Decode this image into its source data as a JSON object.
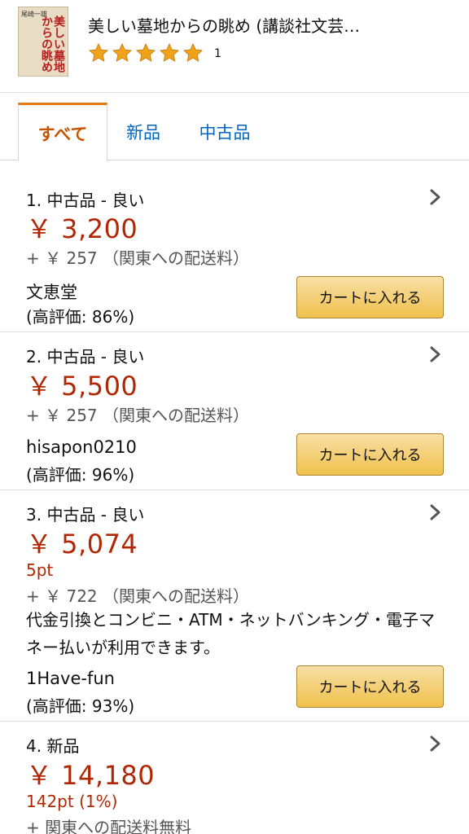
{
  "product": {
    "title": "美しい墓地からの眺め (講談社文芸…",
    "cover_title": "美しい墓地からの眺め",
    "cover_author": "尾崎一雄",
    "rating_stars": 5,
    "rating_count": "1",
    "star_color": "#f0a21a"
  },
  "tabs": [
    {
      "label": "すべて",
      "active": true
    },
    {
      "label": "新品",
      "active": false
    },
    {
      "label": "中古品",
      "active": false
    }
  ],
  "offers": [
    {
      "condition": "1. 中古品 - 良い",
      "price": "￥ 3,200",
      "shipping": "+ ￥ 257 （関東への配送料）",
      "seller": "文恵堂",
      "rating": "(高評価: 86%)",
      "cart_label": "カートに入れる"
    },
    {
      "condition": "2. 中古品 - 良い",
      "price": "￥ 5,500",
      "shipping": "+ ￥ 257 （関東への配送料）",
      "seller": "hisapon0210",
      "rating": "(高評価: 96%)",
      "cart_label": "カートに入れる"
    },
    {
      "condition": "3. 中古品 - 良い",
      "price": "￥ 5,074",
      "points": "5pt",
      "shipping": "+ ￥ 722 （関東への配送料）",
      "note": "代金引換とコンビニ・ATM・ネットバンキング・電子マネー払いが利用できます。",
      "seller": "1Have-fun",
      "rating": "(高評価: 93%)",
      "cart_label": "カートに入れる"
    },
    {
      "condition": "4. 新品",
      "price": "￥ 14,180",
      "points": "142pt (1%)",
      "shipping": "+ 関東への配送料無料"
    }
  ],
  "colors": {
    "price": "#b12704",
    "link": "#0066c0",
    "active_tab": "#c45500",
    "tab_accent": "#e47911",
    "button": "#f0c14b"
  }
}
